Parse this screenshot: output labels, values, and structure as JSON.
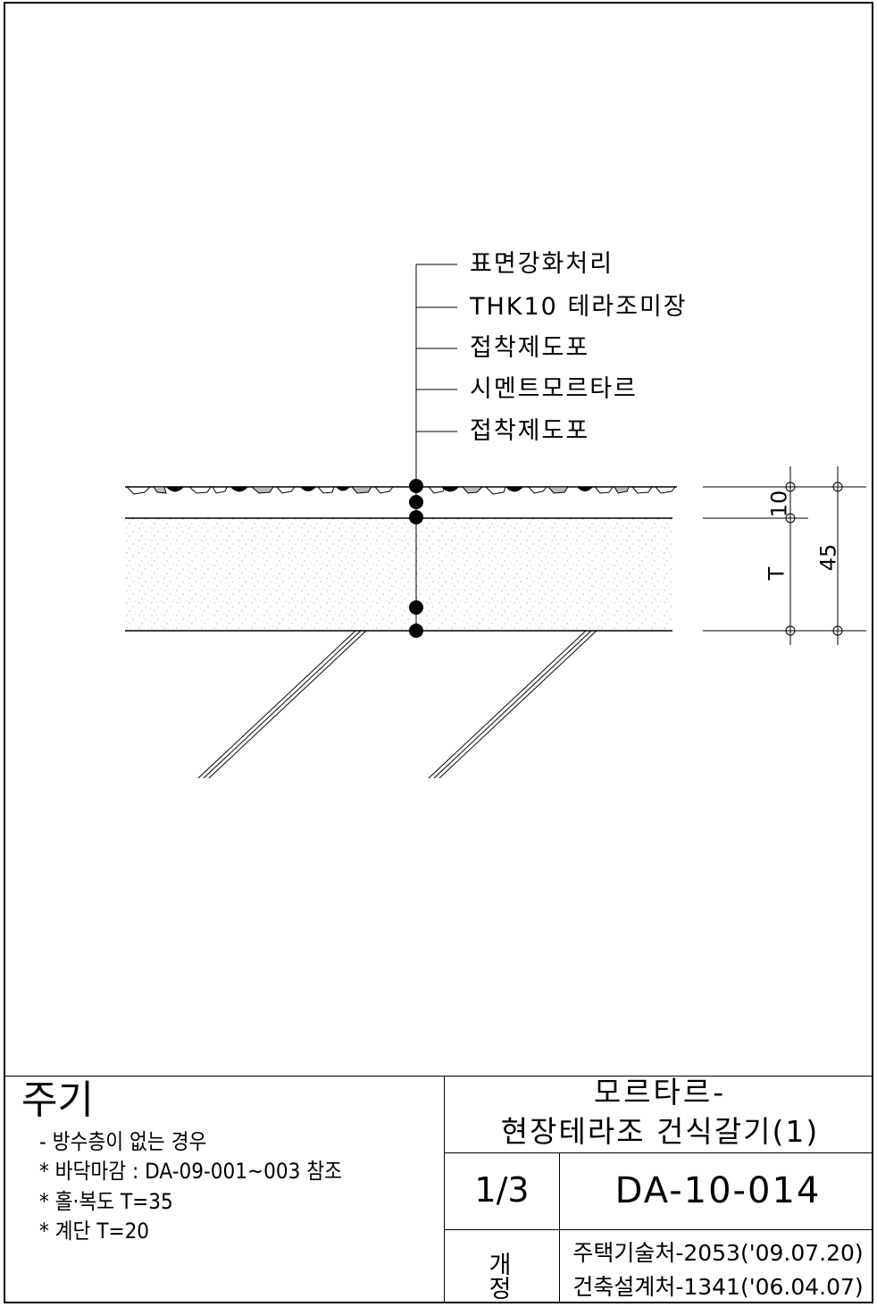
{
  "callouts": [
    "표면강화처리",
    "THK10 테라조미장",
    "접착제도포",
    "시멘트모르타르",
    "접착제도포"
  ],
  "dimensions": {
    "top_layer": "10",
    "total": "45",
    "variable": "T"
  },
  "notes": {
    "title": "주기",
    "items": [
      "- 방수층이 없는 경우",
      "* 바닥마감 : DA-09-001~003 참조",
      "* 홀·복도 T=35",
      "* 계단 T=20"
    ]
  },
  "title_block": {
    "title_line1": "모르타르-",
    "title_line2": "현장테라조 건식갈기(1)",
    "sheet": "1/3",
    "drawing_no": "DA-10-014",
    "revision_label": "개 정",
    "revisions": [
      "주택기술처-2053('09.07.20)",
      "건축설계처-1341('06.04.07)"
    ]
  }
}
